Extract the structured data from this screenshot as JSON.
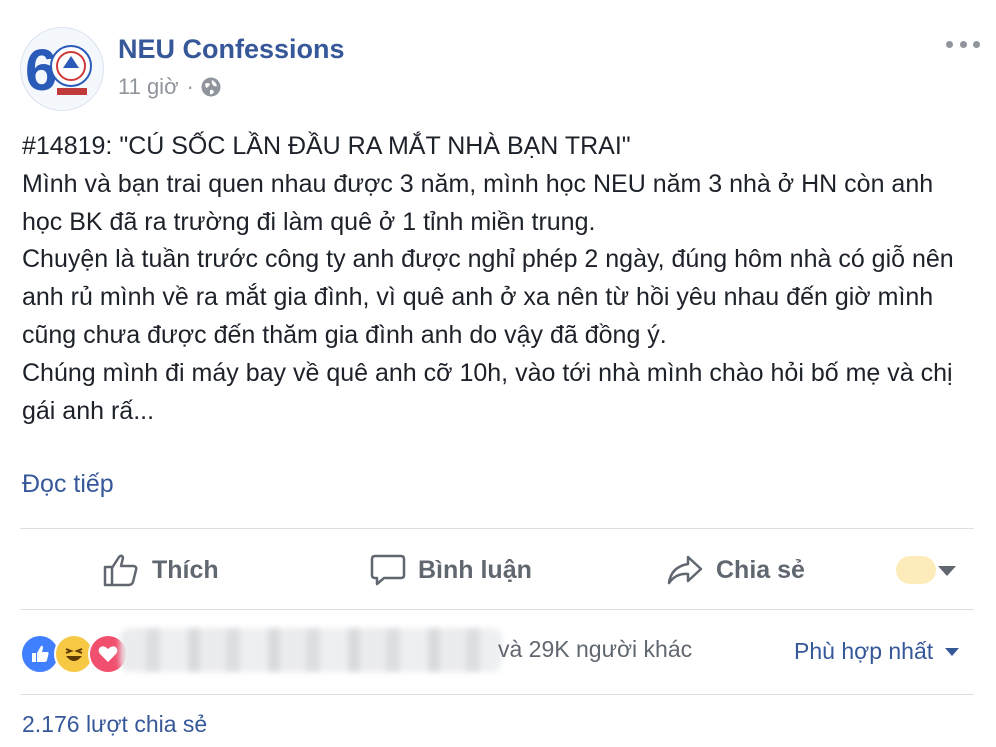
{
  "header": {
    "page_name": "NEU Confessions",
    "time": "11 giờ",
    "separator": "·",
    "avatar_logo_number": "6"
  },
  "post": {
    "paragraphs": [
      "#14819: \"CÚ SỐC LẦN ĐẦU RA MẮT NHÀ BẠN TRAI\"",
      "Mình và bạn trai quen nhau được 3 năm, mình học NEU năm 3 nhà ở HN còn anh học BK đã ra trường đi làm quê ở 1 tỉnh miền trung.",
      "Chuyện là tuần trước công ty anh được nghỉ phép 2 ngày, đúng hôm nhà có giỗ nên anh rủ mình về ra mắt gia đình, vì quê anh ở xa nên từ hồi yêu nhau đến giờ mình cũng chưa được đến thăm gia đình anh do vậy đã đồng ý.",
      "Chúng mình đi máy bay về quê anh cỡ 10h, vào tới nhà mình chào hỏi bố mẹ và chị gái anh rấ..."
    ],
    "read_more": "Đọc tiếp"
  },
  "actions": {
    "like": "Thích",
    "comment": "Bình luận",
    "share": "Chia sẻ"
  },
  "reactions": {
    "others_text": "và 29K người khác",
    "sort_label": "Phù hợp nhất",
    "shares_text": "2.176 lượt chia sẻ"
  },
  "colors": {
    "link_blue": "#365899",
    "secondary_text": "#90949c",
    "action_gray": "#606770",
    "like_blue": "#4080ff",
    "haha_yellow": "#f7c844",
    "love_red": "#f0506e"
  }
}
